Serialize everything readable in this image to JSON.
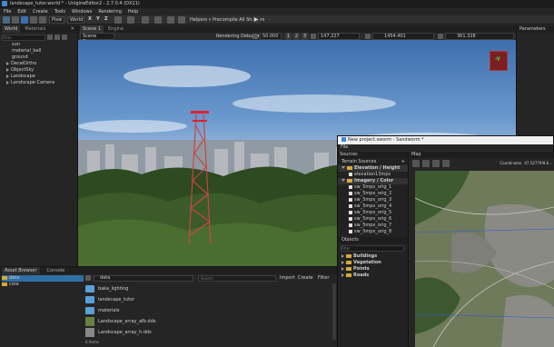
{
  "titlebar": {
    "title": "landscape_tutor.world * - UnigineEditor2 - 2.7.0.4 (DX11)"
  },
  "menu": [
    "File",
    "Edit",
    "Create",
    "Tools",
    "Windows",
    "Rendering",
    "Help"
  ],
  "toolbar": {
    "space_value": "Pixel",
    "coord_value": "World",
    "helpers_label": "Helpers",
    "precompile_label": "Precompile All Shaders"
  },
  "world_panel": {
    "tabs": [
      "World",
      "Materials"
    ],
    "filter_placeholder": "Filter",
    "items": [
      "sun",
      "material_ball",
      "ground",
      "DecalOrtho",
      "ObjectSky",
      "Landscape",
      "Landscape Camera"
    ]
  },
  "scene": {
    "tabs": [
      "Scene 1",
      "Engine"
    ],
    "camera_select": "Scene Camera",
    "rendering_debug": "Rendering Debug",
    "speed": "50.000",
    "buttons": [
      "1",
      "2",
      "3"
    ],
    "angle": "147.227",
    "coord1": "1454.401",
    "coord2": "361.328"
  },
  "parameters_panel": {
    "title": "Parameters"
  },
  "asset_browser": {
    "tabs": [
      "Asset Browser",
      "Console"
    ],
    "tree": [
      "data",
      "core"
    ],
    "path": "data",
    "search_placeholder": "Search",
    "import_label": "Import",
    "create_label": "Create",
    "filter_label": "Filter",
    "files": [
      "baka_lighting",
      "landscape_tutor",
      "materials",
      "Landscape_array_afb.dds",
      "Landscape_array_h.dds"
    ],
    "status": "6 items"
  },
  "sandworm": {
    "title": "New project.sworm - Sandworm *",
    "menu_file": "File",
    "sources_tab": "Sources",
    "map_tab": "Map",
    "terrain_sources_label": "Terrain Sources",
    "elevation_label": "Elevation / Height",
    "elevation_file": "elevation13mps",
    "imagery_label": "Imagery / Color",
    "imagery_files": [
      "sw_5mpx_orig_1",
      "sw_5mpx_orig_2",
      "sw_5mpx_orig_3",
      "sw_5mpx_orig_4",
      "sw_5mpx_orig_5",
      "sw_5mpx_orig_6",
      "sw_5mpx_orig_7",
      "sw_5mpx_orig_8"
    ],
    "objects_label": "Objects",
    "filter_placeholder": "Filter",
    "objects": [
      "Buildings",
      "Vegetation",
      "Points",
      "Roads"
    ],
    "coordinates_label": "Coordinates",
    "coordinates_value": "47.52779/8.6..."
  },
  "colors": {
    "panel_bg": "#2b2b2b",
    "panel_dark": "#1e1e1e",
    "accent": "#2f6fa8",
    "folder": "#d8a93a"
  }
}
